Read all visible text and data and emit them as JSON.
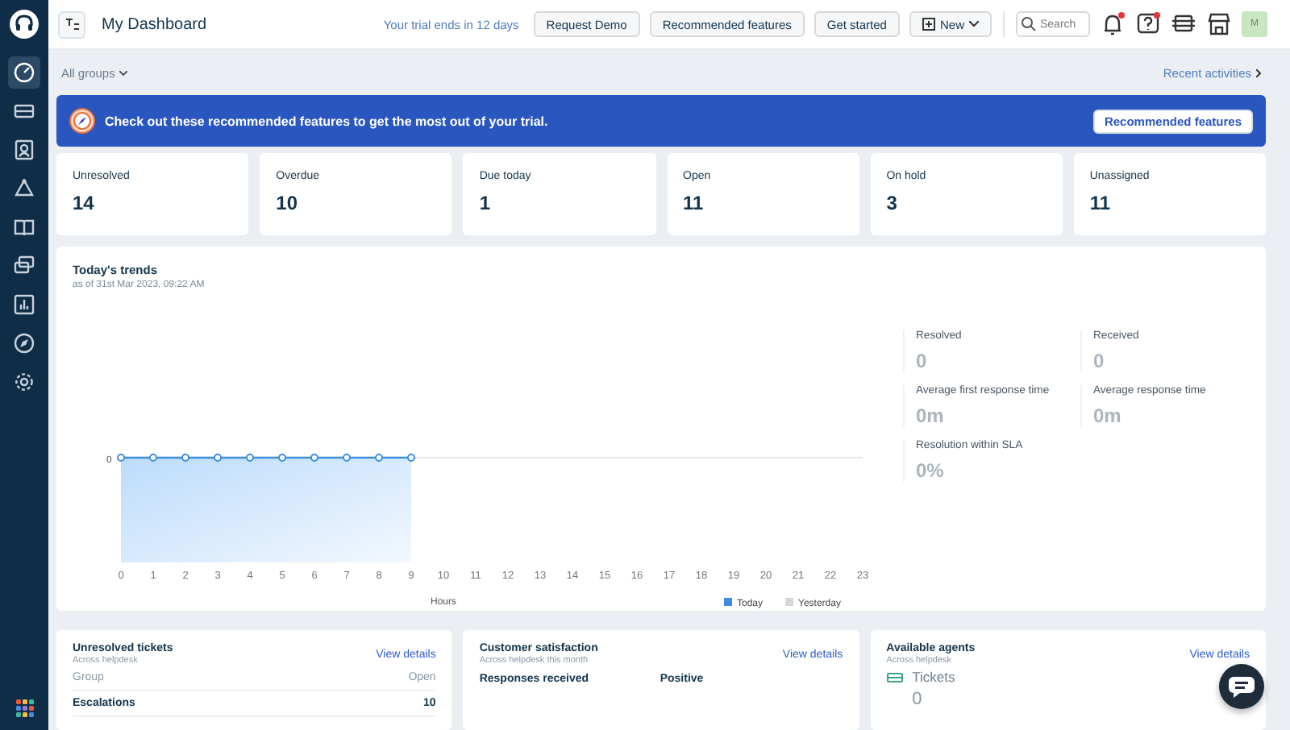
{
  "sidebar": {
    "items": [
      {
        "selected": true
      },
      {
        "selected": false
      },
      {
        "selected": false
      },
      {
        "selected": false
      },
      {
        "selected": false
      },
      {
        "selected": false
      },
      {
        "selected": false
      },
      {
        "selected": false
      },
      {
        "selected": false
      }
    ]
  },
  "header": {
    "title": "My Dashboard",
    "trial": "Your trial ends in 12 days",
    "buttons": [
      {
        "label": "Request Demo",
        "kind": "plain"
      },
      {
        "label": "Recommended features",
        "kind": "plain"
      },
      {
        "label": "Get started",
        "kind": "plain"
      },
      {
        "label": "New",
        "kind": "dropdown"
      }
    ],
    "search": {
      "placeholder": "Search"
    },
    "icons": [
      {
        "alert": true
      },
      {
        "alert": true
      },
      {
        "alert": false
      },
      {
        "alert": false
      }
    ],
    "avatar": "M"
  },
  "filter": {
    "group": "All groups",
    "recent": "Recent activities"
  },
  "banner": {
    "text": "Check out these recommended features to get the most out of your trial.",
    "button": "Recommended features"
  },
  "stats": [
    {
      "label": "Unresolved",
      "value": "14"
    },
    {
      "label": "Overdue",
      "value": "10"
    },
    {
      "label": "Due today",
      "value": "1"
    },
    {
      "label": "Open",
      "value": "11"
    },
    {
      "label": "On hold",
      "value": "3"
    },
    {
      "label": "Unassigned",
      "value": "11"
    }
  ],
  "trends": {
    "title": "Today's trends",
    "subtitle": "as of 31st Mar 2023, 09:22 AM",
    "chart": {
      "y_axis_value": "0",
      "xlabel": "Hours",
      "hours": [
        "0",
        "1",
        "2",
        "3",
        "4",
        "5",
        "6",
        "7",
        "8",
        "9",
        "10",
        "11",
        "12",
        "13",
        "14",
        "15",
        "16",
        "17",
        "18",
        "19",
        "20",
        "21",
        "22",
        "23"
      ],
      "legend": [
        {
          "name": "Today",
          "color": "#3d8fdd"
        },
        {
          "name": "Yesterday",
          "color": "#d4d6d9"
        }
      ]
    },
    "metrics": [
      {
        "label": "Resolved",
        "value": "0"
      },
      {
        "label": "Received",
        "value": "0"
      },
      {
        "label": "Average first response time",
        "value": "0m"
      },
      {
        "label": "Average response time",
        "value": "0m"
      },
      {
        "label": "Resolution within SLA",
        "value": "0%"
      }
    ]
  },
  "cards": [
    {
      "kind": "table",
      "title": "Unresolved tickets",
      "subtitle": "Across helpdesk",
      "link": "View details",
      "columns": [
        "Group",
        "Open"
      ],
      "rows": [
        [
          "Escalations",
          "10"
        ]
      ]
    },
    {
      "kind": "csat",
      "title": "Customer satisfaction",
      "subtitle": "Across helpdesk this month",
      "link": "View details",
      "columns": [
        "Responses received",
        "Positive"
      ]
    },
    {
      "kind": "agents",
      "title": "Available agents",
      "subtitle": "Across helpdesk",
      "link": "View details",
      "metric": "Tickets",
      "value": "0"
    }
  ]
}
